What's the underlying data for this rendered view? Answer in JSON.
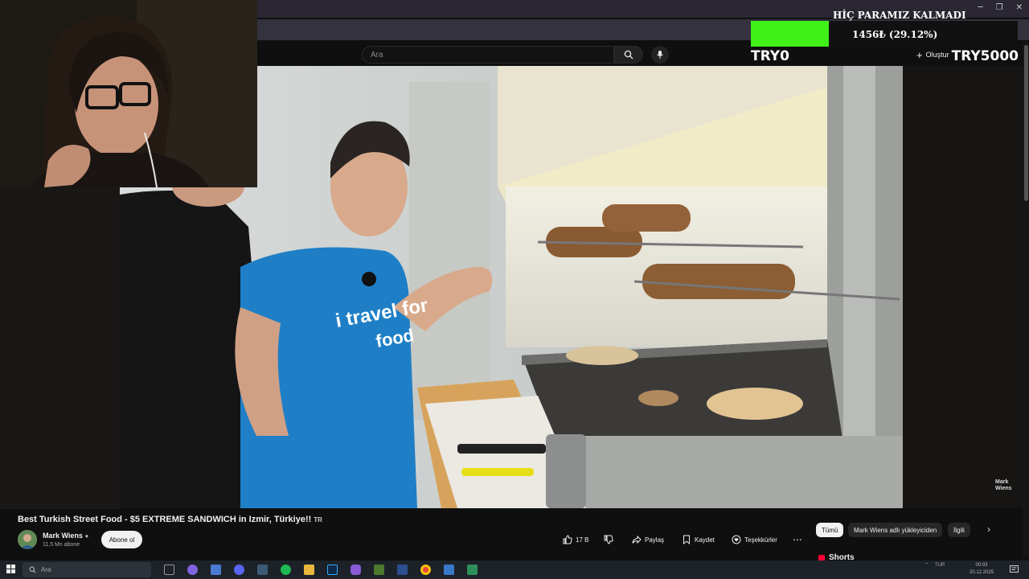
{
  "overlay": {
    "title": "HİÇ PARAMIZ KALMADI",
    "progress_text": "1456₺ (29.12%)",
    "progress_fraction": 0.2912,
    "goal_min": "TRY0",
    "goal_max": "TRY5000",
    "bar_color": "#3ff019"
  },
  "header": {
    "search_placeholder": "Ara",
    "create_label": "Oluştur"
  },
  "video": {
    "watermark_line1": "Mark",
    "watermark_line2": "Wiens",
    "shirt_text_1": "i travel for",
    "shirt_text_2": "food",
    "title": "Best Turkish Street Food - $5 EXTREME SANDWICH in Izmir, Türkiye!!",
    "title_flag": "TR"
  },
  "channel": {
    "name": "Mark Wiens",
    "subscribers": "11,5 Mn abone",
    "subscribe_label": "Abone ol"
  },
  "actions": {
    "likes": "17 B",
    "share": "Paylaş",
    "save": "Kaydet",
    "thanks": "Teşekkürler",
    "more": "⋯"
  },
  "sidebar": {
    "chips": [
      "Tümü",
      "Mark Wiens adlı yükleyiciden",
      "İlgili"
    ],
    "shorts_label": "Shorts"
  },
  "taskbar": {
    "search_placeholder": "Ara",
    "lang": "TUR",
    "time": "00:03",
    "date": "20.12.2025"
  },
  "colors": {
    "youtube_red": "#ff0033",
    "background": "#0f0f0f"
  }
}
